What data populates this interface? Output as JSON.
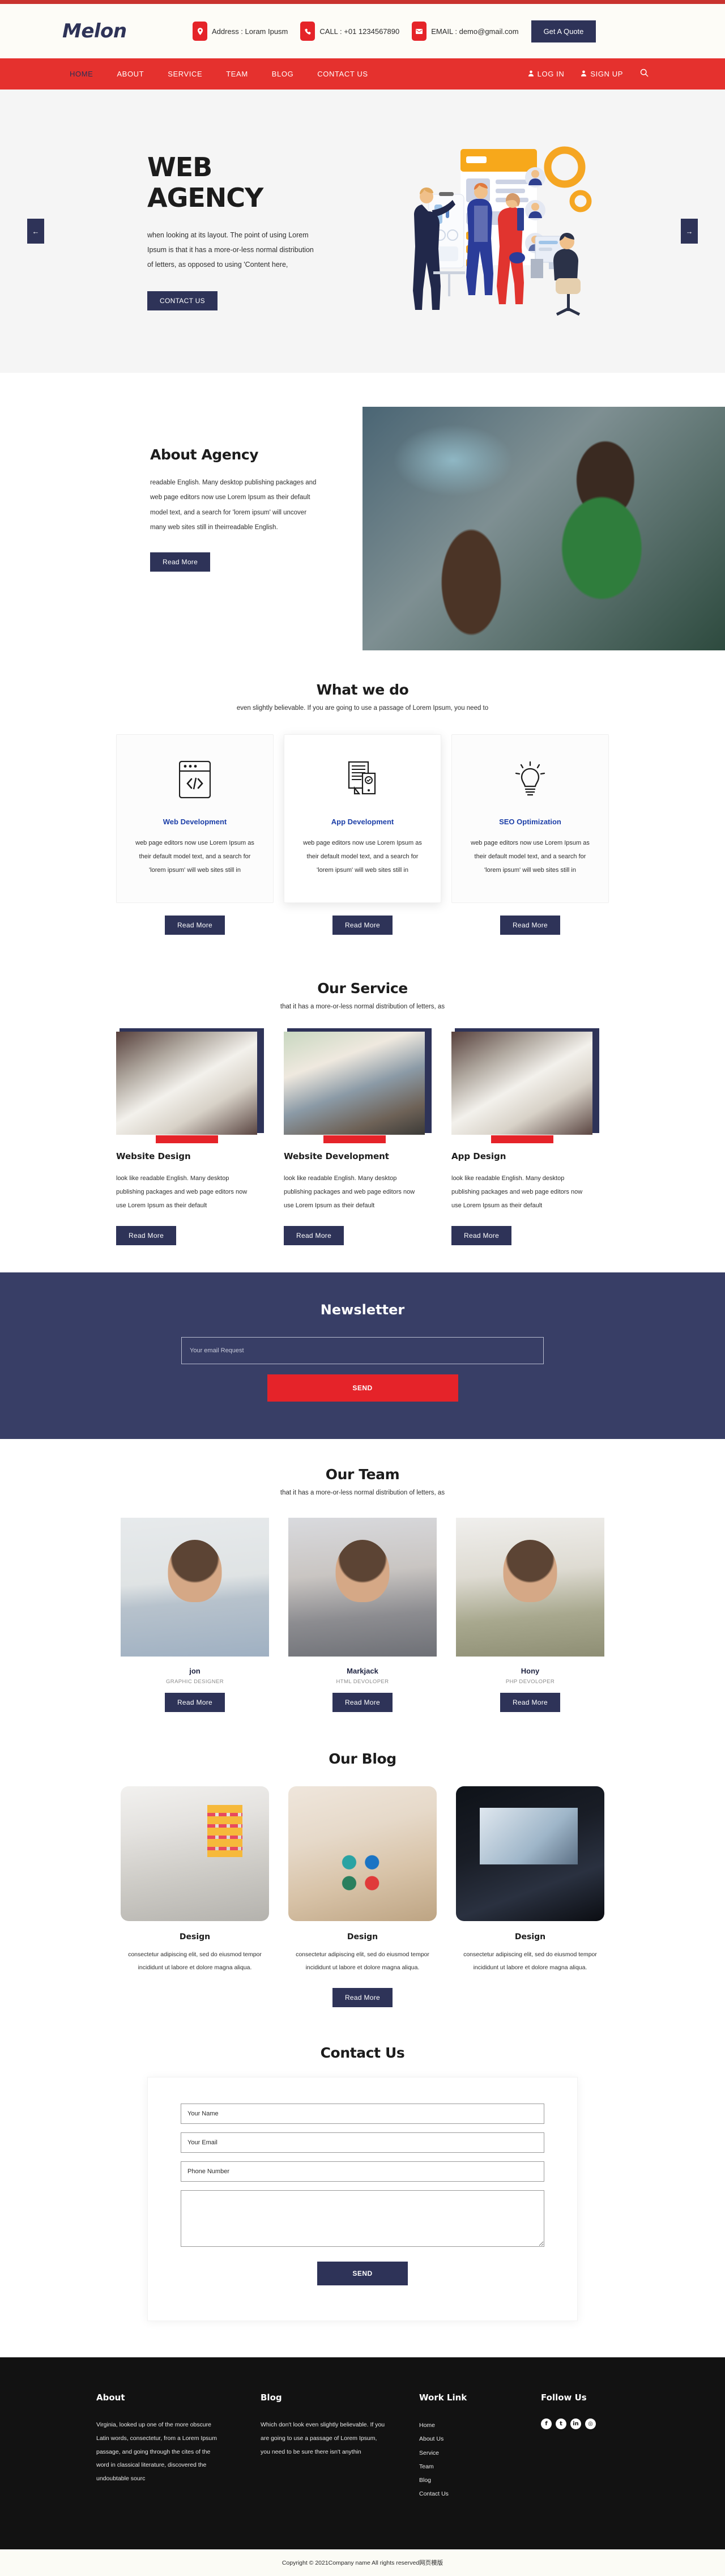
{
  "brand": {
    "name": "Melon",
    "accent_red": "#e5312e",
    "accent_navy": "#2e3358"
  },
  "header": {
    "contacts": [
      {
        "icon": "location-pin-icon",
        "text": "Address : Loram Ipusm"
      },
      {
        "icon": "phone-icon",
        "text": "CALL : +01 1234567890"
      },
      {
        "icon": "envelope-icon",
        "text": "EMAIL : demo@gmail.com"
      }
    ],
    "quote_button": "Get A Quote"
  },
  "nav": {
    "items": [
      {
        "label": "HOME",
        "active": true
      },
      {
        "label": "ABOUT",
        "active": false
      },
      {
        "label": "SERVICE",
        "active": false
      },
      {
        "label": "TEAM",
        "active": false
      },
      {
        "label": "BLOG",
        "active": false
      },
      {
        "label": "CONTACT US",
        "active": false
      }
    ],
    "login": "LOG IN",
    "signup": "SIGN UP",
    "search_icon": "search-icon"
  },
  "hero": {
    "title": "WEB AGENCY",
    "description": "when looking at its layout. The point of using Lorem Ipsum is that it has a more-or-less normal distribution of letters, as opposed to using 'Content here,",
    "cta": "CONTACT US",
    "prev_arrow": "←",
    "next_arrow": "→"
  },
  "about": {
    "title": "About Agency",
    "description": "readable English. Many desktop publishing packages and web page editors now use Lorem Ipsum as their default model text, and a search for 'lorem ipsum' will uncover many web sites still in theirreadable English.",
    "cta": "Read More"
  },
  "whatwedo": {
    "title": "What we do",
    "subtitle": "even slightly believable. If you are going to use a passage of Lorem Ipsum, you need to",
    "cards": [
      {
        "icon": "code-window-icon",
        "title": "Web Development",
        "desc": "web page editors now use Lorem Ipsum as their default model text, and a search for 'lorem ipsum' will web sites still in",
        "cta": "Read More"
      },
      {
        "icon": "document-monitor-icon",
        "title": "App Development",
        "desc": "web page editors now use Lorem Ipsum as their default model text, and a search for 'lorem ipsum' will web sites still in",
        "cta": "Read More"
      },
      {
        "icon": "lightbulb-icon",
        "title": "SEO Optimization",
        "desc": "web page editors now use Lorem Ipsum as their default model text, and a search for 'lorem ipsum' will web sites still in",
        "cta": "Read More"
      }
    ]
  },
  "service": {
    "title": "Our Service",
    "subtitle": "that it has a more-or-less normal distribution of letters, as",
    "cards": [
      {
        "title": "Website Design",
        "desc": "look like readable English. Many desktop publishing packages and web page editors now use Lorem Ipsum as their default",
        "cta": "Read More"
      },
      {
        "title": "Website Development",
        "desc": "look like readable English. Many desktop publishing packages and web page editors now use Lorem Ipsum as their default",
        "cta": "Read More"
      },
      {
        "title": "App Design",
        "desc": "look like readable English. Many desktop publishing packages and web page editors now use Lorem Ipsum as their default",
        "cta": "Read More"
      }
    ]
  },
  "newsletter": {
    "title": "Newsletter",
    "placeholder": "Your email Request",
    "send": "SEND"
  },
  "team": {
    "title": "Our Team",
    "subtitle": "that it has a more-or-less normal distribution of letters, as",
    "members": [
      {
        "name": "jon",
        "role": "GRAPHIC DESIGNER",
        "cta": "Read More"
      },
      {
        "name": "Markjack",
        "role": "HTML DEVOLOPER",
        "cta": "Read More"
      },
      {
        "name": "Hony",
        "role": "PHP DEVOLOPER",
        "cta": "Read More"
      }
    ]
  },
  "blog": {
    "title": "Our Blog",
    "posts": [
      {
        "title": "Design",
        "desc": "consectetur adipiscing elit, sed do eiusmod tempor incididunt ut labore et dolore magna aliqua."
      },
      {
        "title": "Design",
        "desc": "consectetur adipiscing elit, sed do eiusmod tempor incididunt ut labore et dolore magna aliqua."
      },
      {
        "title": "Design",
        "desc": "consectetur adipiscing elit, sed do eiusmod tempor incididunt ut labore et dolore magna aliqua."
      }
    ],
    "cta": "Read More"
  },
  "contact": {
    "title": "Contact Us",
    "name_placeholder": "Your Name",
    "email_placeholder": "Your Email",
    "phone_placeholder": "Phone Number",
    "message_placeholder": "",
    "send": "SEND"
  },
  "footer": {
    "about": {
      "heading": "About",
      "text": "Virginia, looked up one of the more obscure Latin words, consectetur, from a Lorem Ipsum passage, and going through the cites of the word in classical literature, discovered the undoubtable sourc"
    },
    "blog": {
      "heading": "Blog",
      "text": "Which don't look even slightly believable. If you are going to use a passage of Lorem Ipsum, you need to be sure there isn't anythin"
    },
    "work": {
      "heading": "Work Link",
      "links": [
        "Home",
        "About Us",
        "Service",
        "Team",
        "Blog",
        "Contact Us"
      ]
    },
    "follow": {
      "heading": "Follow Us",
      "socials": [
        {
          "icon": "facebook-icon",
          "glyph": "f"
        },
        {
          "icon": "twitter-icon",
          "glyph": "t"
        },
        {
          "icon": "linkedin-icon",
          "glyph": "in"
        },
        {
          "icon": "instagram-icon",
          "glyph": "◎"
        }
      ]
    },
    "copyright": "Copyright © 2021Company name All rights reserved",
    "copyright_link": "网页模版"
  }
}
